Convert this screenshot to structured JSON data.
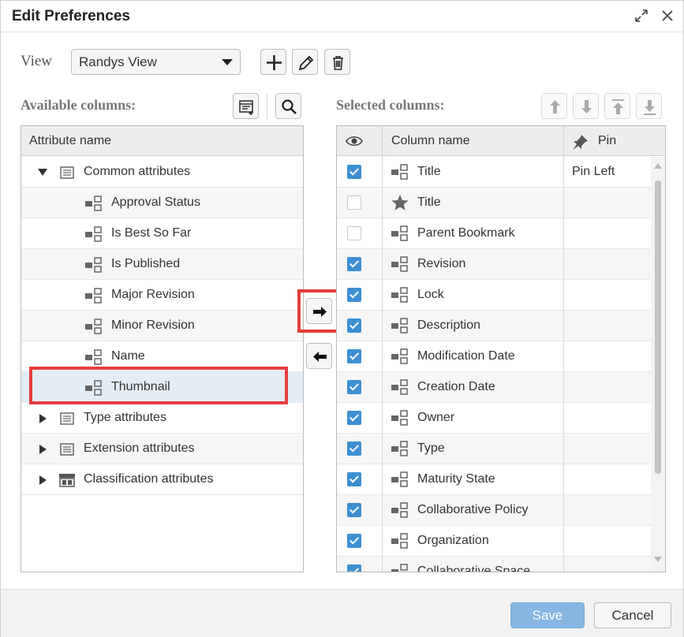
{
  "dialog": {
    "title": "Edit Preferences"
  },
  "view": {
    "label": "View",
    "selected": "Randys View"
  },
  "available": {
    "label": "Available columns:",
    "header": "Attribute name",
    "rows": [
      {
        "label": "Common attributes",
        "kind": "group",
        "expanded": true
      },
      {
        "label": "Approval Status",
        "kind": "attr"
      },
      {
        "label": "Is Best So Far",
        "kind": "attr"
      },
      {
        "label": "Is Published",
        "kind": "attr"
      },
      {
        "label": "Major Revision",
        "kind": "attr"
      },
      {
        "label": "Minor Revision",
        "kind": "attr"
      },
      {
        "label": "Name",
        "kind": "attr"
      },
      {
        "label": "Thumbnail",
        "kind": "attr",
        "selected": true
      },
      {
        "label": "Type attributes",
        "kind": "group",
        "expanded": false
      },
      {
        "label": "Extension attributes",
        "kind": "group",
        "expanded": false
      },
      {
        "label": "Classification attributes",
        "kind": "group-class",
        "expanded": false
      }
    ]
  },
  "selected": {
    "label": "Selected columns:",
    "header_column": "Column name",
    "header_pin": "Pin",
    "rows": [
      {
        "label": "Title",
        "checked": true,
        "icon": "attr",
        "pin": "Pin Left"
      },
      {
        "label": "Title",
        "checked": false,
        "icon": "star",
        "pin": ""
      },
      {
        "label": "Parent Bookmark",
        "checked": false,
        "icon": "attr",
        "pin": ""
      },
      {
        "label": "Revision",
        "checked": true,
        "icon": "attr",
        "pin": ""
      },
      {
        "label": "Lock",
        "checked": true,
        "icon": "attr",
        "pin": ""
      },
      {
        "label": "Description",
        "checked": true,
        "icon": "attr",
        "pin": ""
      },
      {
        "label": "Modification Date",
        "checked": true,
        "icon": "attr",
        "pin": ""
      },
      {
        "label": "Creation Date",
        "checked": true,
        "icon": "attr",
        "pin": ""
      },
      {
        "label": "Owner",
        "checked": true,
        "icon": "attr",
        "pin": ""
      },
      {
        "label": "Type",
        "checked": true,
        "icon": "attr",
        "pin": ""
      },
      {
        "label": "Maturity State",
        "checked": true,
        "icon": "attr",
        "pin": ""
      },
      {
        "label": "Collaborative Policy",
        "checked": true,
        "icon": "attr",
        "pin": ""
      },
      {
        "label": "Organization",
        "checked": true,
        "icon": "attr",
        "pin": ""
      },
      {
        "label": "Collaborative Space",
        "checked": true,
        "icon": "attr",
        "pin": ""
      }
    ]
  },
  "footer": {
    "save": "Save",
    "cancel": "Cancel"
  },
  "colors": {
    "accent": "#3d8fd1",
    "highlight": "#e53d3d",
    "save_button": "#86b6e1"
  }
}
